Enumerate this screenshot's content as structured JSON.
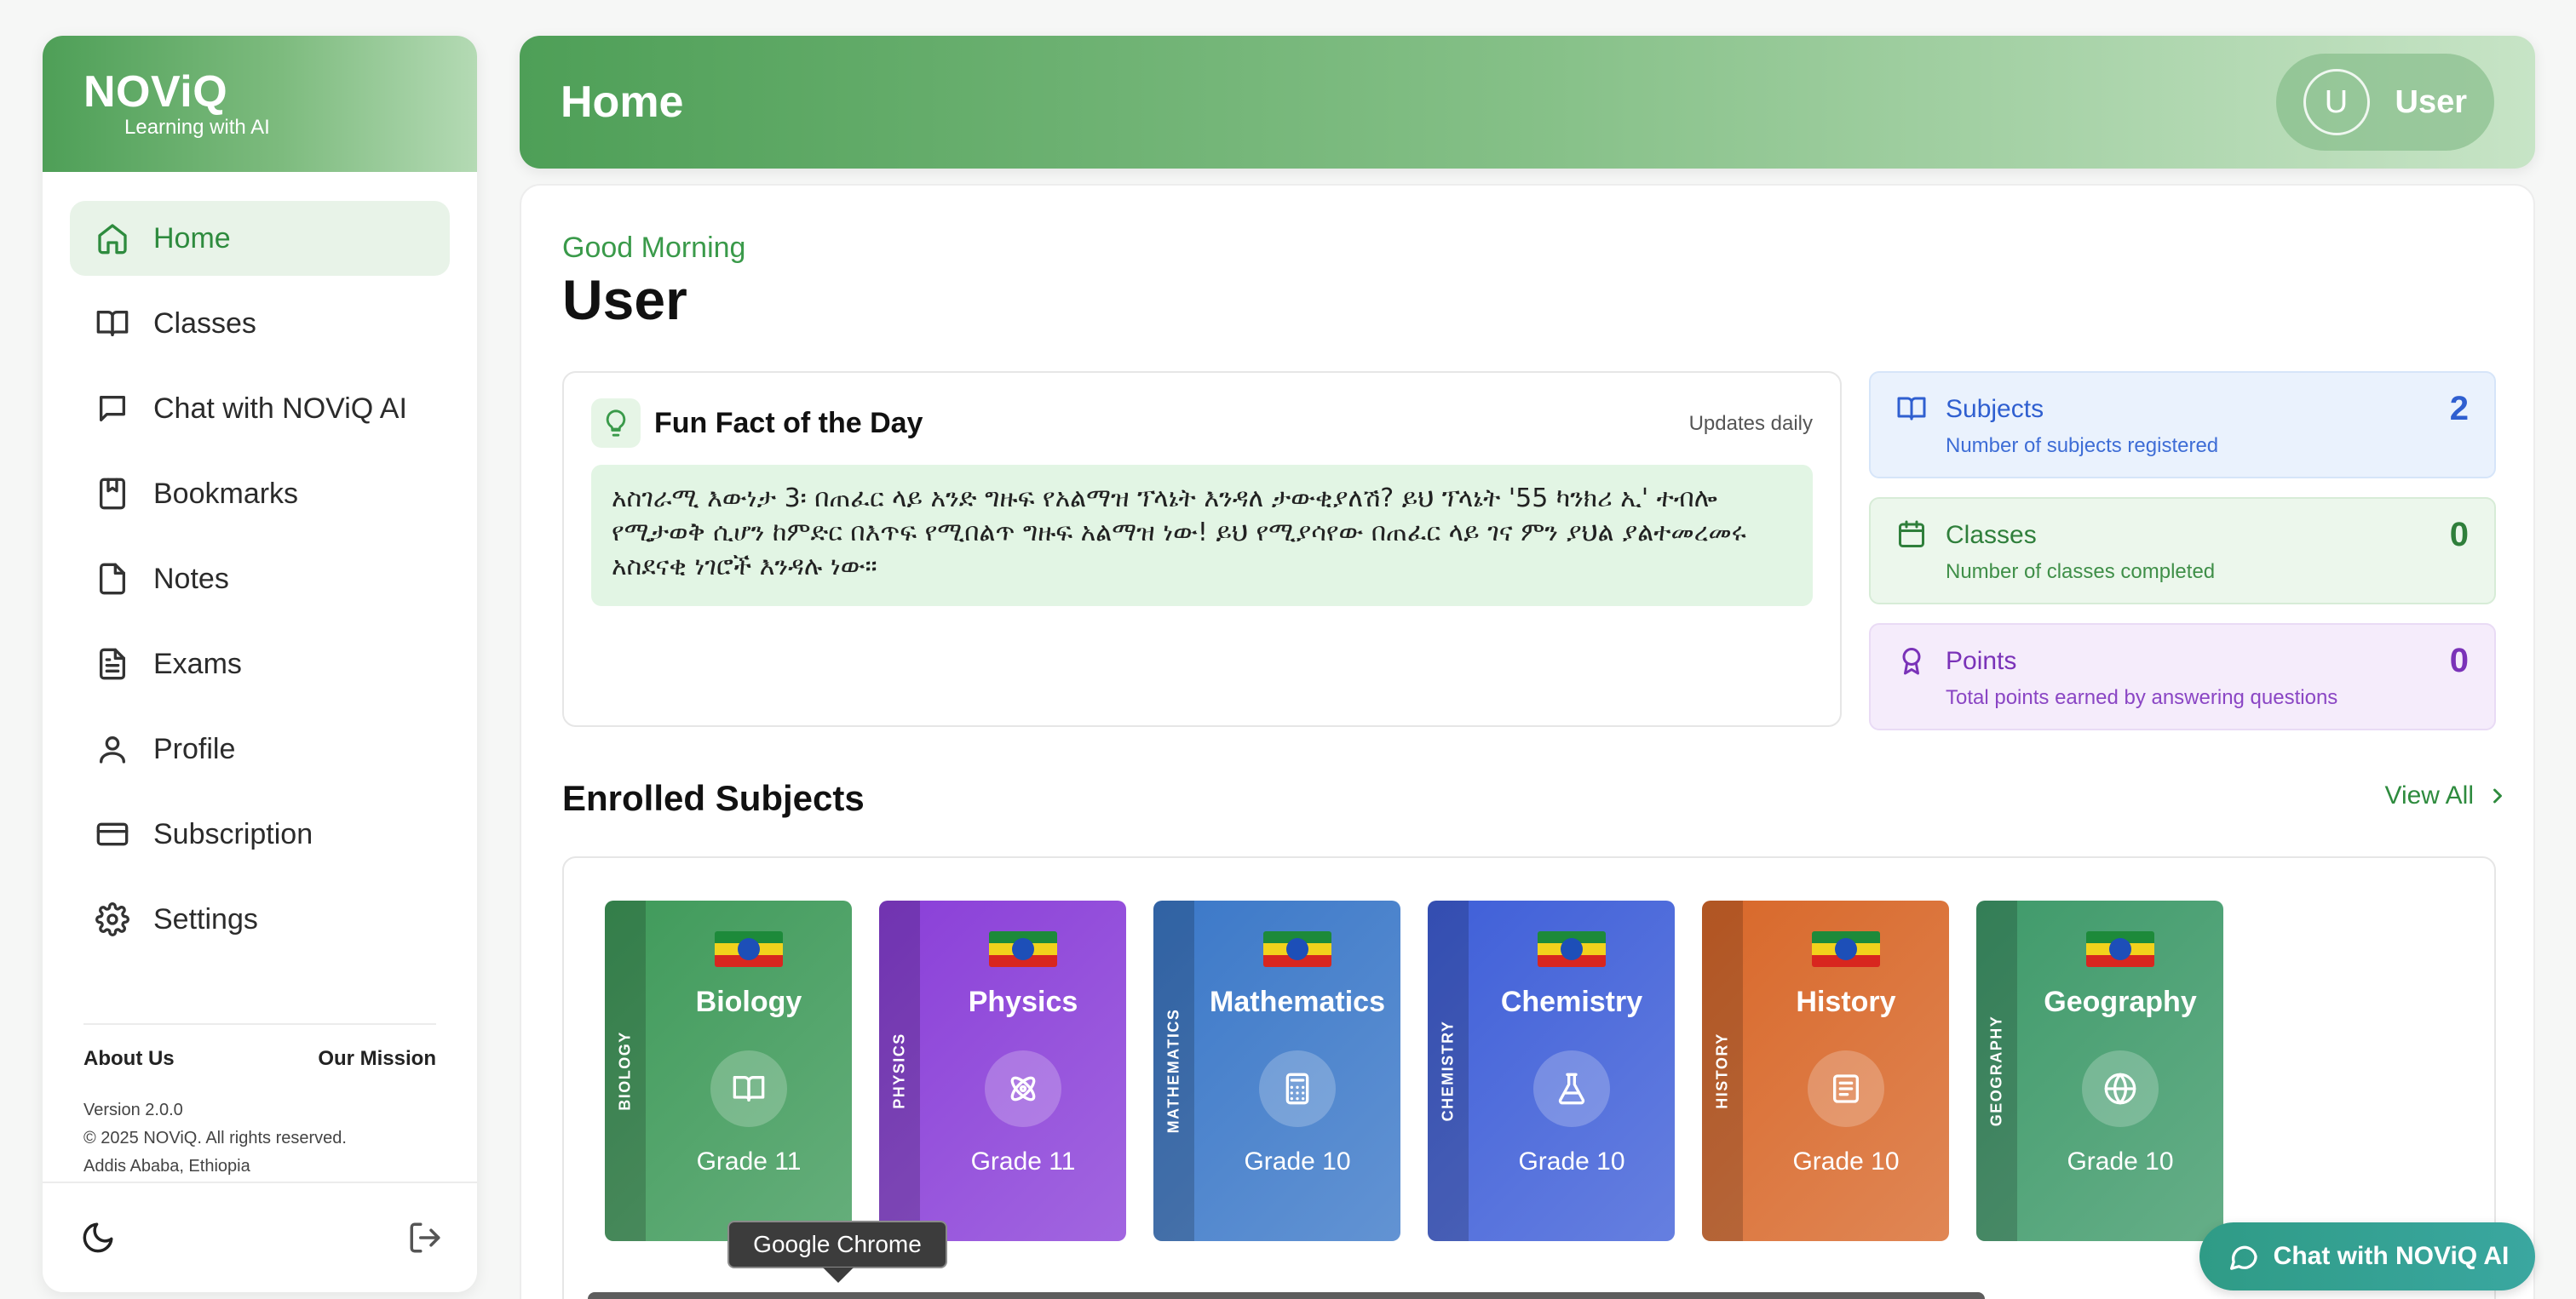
{
  "brand": {
    "name": "NOViQ",
    "tagline": "Learning with AI"
  },
  "nav": [
    {
      "label": "Home",
      "icon": "home-icon",
      "active": true
    },
    {
      "label": "Classes",
      "icon": "book-open-icon"
    },
    {
      "label": "Chat with NOViQ AI",
      "icon": "chat-icon"
    },
    {
      "label": "Bookmarks",
      "icon": "bookmark-icon"
    },
    {
      "label": "Notes",
      "icon": "note-icon"
    },
    {
      "label": "Exams",
      "icon": "document-icon"
    },
    {
      "label": "Profile",
      "icon": "user-icon"
    },
    {
      "label": "Subscription",
      "icon": "credit-card-icon"
    },
    {
      "label": "Settings",
      "icon": "gear-icon"
    }
  ],
  "footer": {
    "about": "About Us",
    "mission": "Our Mission",
    "version": "Version 2.0.0",
    "copyright": "© 2025 NOViQ. All rights reserved.",
    "location": "Addis Ababa, Ethiopia"
  },
  "header": {
    "title": "Home",
    "avatar_initial": "U",
    "user_name": "User"
  },
  "greeting": {
    "salutation": "Good Morning",
    "name": "User"
  },
  "fun_fact": {
    "title": "Fun Fact of the Day",
    "updates": "Updates daily",
    "text": "አስገራሚ እውነታ 3፡ በጠፈር ላይ አንድ ግዙፍ የአልማዝ ፕላኔት እንዳለ ታውቂያለሽ? ይህ ፕላኔት '55 ካንክሪ ኢ' ተብሎ የሚታወቅ ሲሆን ከምድር በእጥፍ የሚበልጥ ግዙፍ አልማዝ ነው! ይህ የሚያሳየው በጠፈር ላይ ገና ምን ያህል ያልተመረመሩ አስደናቂ ነገሮች እንዳሉ ነው።"
  },
  "stats": [
    {
      "label": "Subjects",
      "description": "Number of subjects registered",
      "value": "2",
      "color": "#2f5fd0"
    },
    {
      "label": "Classes",
      "description": "Number of classes completed",
      "value": "0",
      "color": "#2f7f3b"
    },
    {
      "label": "Points",
      "description": "Total points earned by answering questions",
      "value": "0",
      "color": "#7a32b8"
    }
  ],
  "enrolled": {
    "title": "Enrolled Subjects",
    "view_all": "View All",
    "subjects": [
      {
        "name": "Biology",
        "spine": "BIOLOGY",
        "grade": "Grade 11",
        "icon": "book-open-icon",
        "color": "#3f9a5a"
      },
      {
        "name": "Physics",
        "spine": "PHYSICS",
        "grade": "Grade 11",
        "icon": "atom-icon",
        "color": "#8a3fd8"
      },
      {
        "name": "Mathematics",
        "spine": "MATHEMATICS",
        "grade": "Grade 10",
        "icon": "calculator-icon",
        "color": "#3b78c8"
      },
      {
        "name": "Chemistry",
        "spine": "CHEMISTRY",
        "grade": "Grade 10",
        "icon": "flask-icon",
        "color": "#3f5fd8"
      },
      {
        "name": "History",
        "spine": "HISTORY",
        "grade": "Grade 10",
        "icon": "scroll-icon",
        "color": "#d8682a"
      },
      {
        "name": "Geography",
        "spine": "GEOGRAPHY",
        "grade": "Grade 10",
        "icon": "globe-icon",
        "color": "#3f9a6a"
      }
    ]
  },
  "tooltip": "Google Chrome",
  "chat_fab": "Chat with NOViQ AI"
}
